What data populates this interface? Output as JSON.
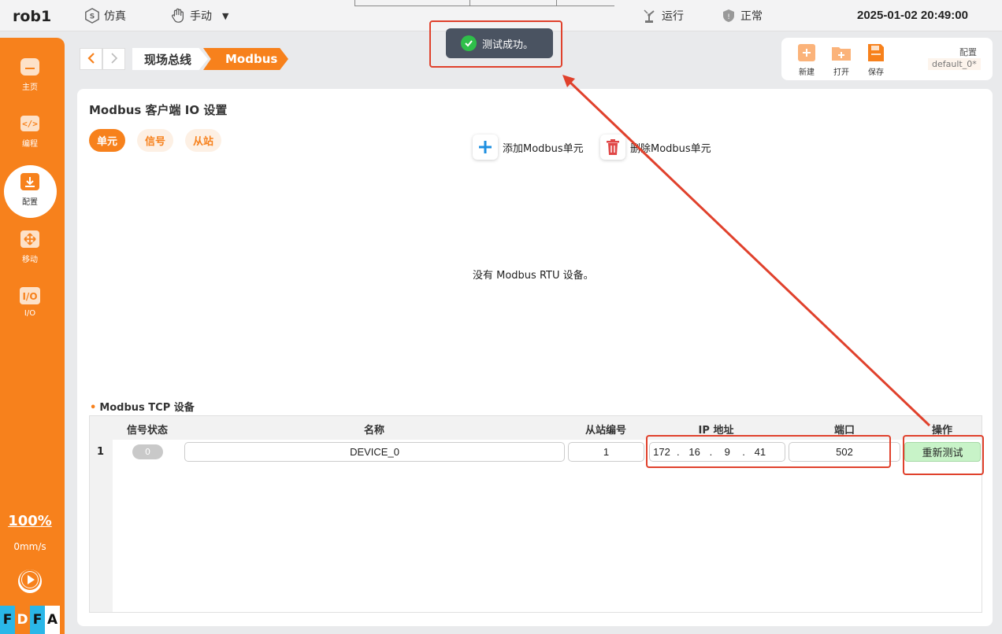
{
  "topbar": {
    "robot_name": "rob1",
    "sim_label": "仿真",
    "manual_label": "手动",
    "run_label": "运行",
    "status_label": "正常",
    "datetime": "2025-01-02 20:49:00"
  },
  "sidebar": {
    "items": [
      {
        "label": "主页",
        "icon": "home-icon"
      },
      {
        "label": "编程",
        "icon": "code-icon"
      },
      {
        "label": "配置",
        "icon": "config-icon"
      },
      {
        "label": "移动",
        "icon": "move-icon"
      },
      {
        "label": "I/O",
        "icon": "io-icon"
      }
    ],
    "speed_percent": "100%",
    "speed_mm": "0mm/s",
    "flags": [
      "F",
      "D",
      "F",
      "A"
    ]
  },
  "breadcrumb": {
    "items": [
      "现场总线",
      "Modbus"
    ]
  },
  "config_panel": {
    "new_label": "新建",
    "open_label": "打开",
    "save_label": "保存",
    "config_label": "配置",
    "config_name": "default_0*"
  },
  "main": {
    "title": "Modbus 客户端 IO 设置",
    "tabs": [
      "单元",
      "信号",
      "从站"
    ],
    "add_label": "添加Modbus单元",
    "delete_label": "删除Modbus单元",
    "empty_rtu": "没有 Modbus RTU 设备。",
    "tcp_section": "Modbus TCP 设备"
  },
  "table": {
    "headers": [
      "信号状态",
      "名称",
      "从站编号",
      "IP 地址",
      "端口",
      "操作"
    ],
    "rows": [
      {
        "index": "1",
        "status": "0",
        "name": "DEVICE_0",
        "slave_id": "1",
        "ip": [
          "172",
          "16",
          "9",
          "41"
        ],
        "port": "502",
        "action": "重新测试"
      }
    ]
  },
  "toast": {
    "message": "测试成功。"
  },
  "colors": {
    "accent": "#f7811c",
    "annotation": "#e0412c",
    "success": "#2fbf4a",
    "retest_bg": "#c8f3c8"
  }
}
